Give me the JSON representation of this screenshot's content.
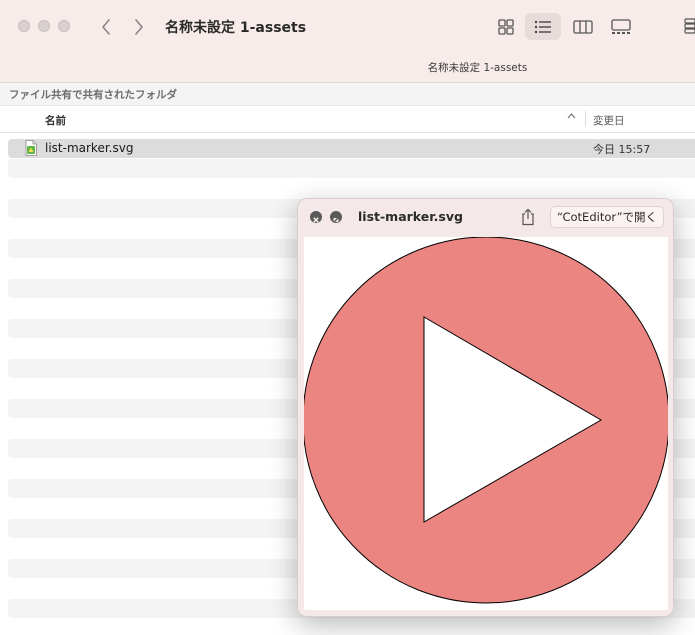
{
  "window": {
    "title": "名称未設定 1-assets",
    "path_label": "名称未設定 1-assets"
  },
  "toolbar": {
    "back_icon": "chevron-left-icon",
    "forward_icon": "chevron-right-icon",
    "views": [
      "icon-view",
      "list-view",
      "column-view",
      "gallery-view"
    ],
    "active_view": "list-view",
    "edge_icon": "group-icon"
  },
  "banner": {
    "text": "ファイル共有で共有されたフォルダ"
  },
  "columns": {
    "name": "名前",
    "date": "変更日",
    "sort_icon": "chevron-up-icon"
  },
  "files": [
    {
      "name": "list-marker.svg",
      "date": "今日 15:57",
      "icon": "svg-file-icon"
    }
  ],
  "quicklook": {
    "title": "list-marker.svg",
    "open_with_label": "“CotEditor”で開く",
    "share_icon": "share-icon",
    "close_icon": "close-icon",
    "fullscreen_icon": "fullscreen-icon",
    "preview": {
      "circle_fill": "#eb8581",
      "triangle_fill": "#ffffff",
      "stroke": "#000000"
    }
  },
  "colors": {
    "toolbar_bg": "#f8ecea",
    "panel_bg": "#f4e9e8",
    "selection": "#dcdcdc"
  }
}
